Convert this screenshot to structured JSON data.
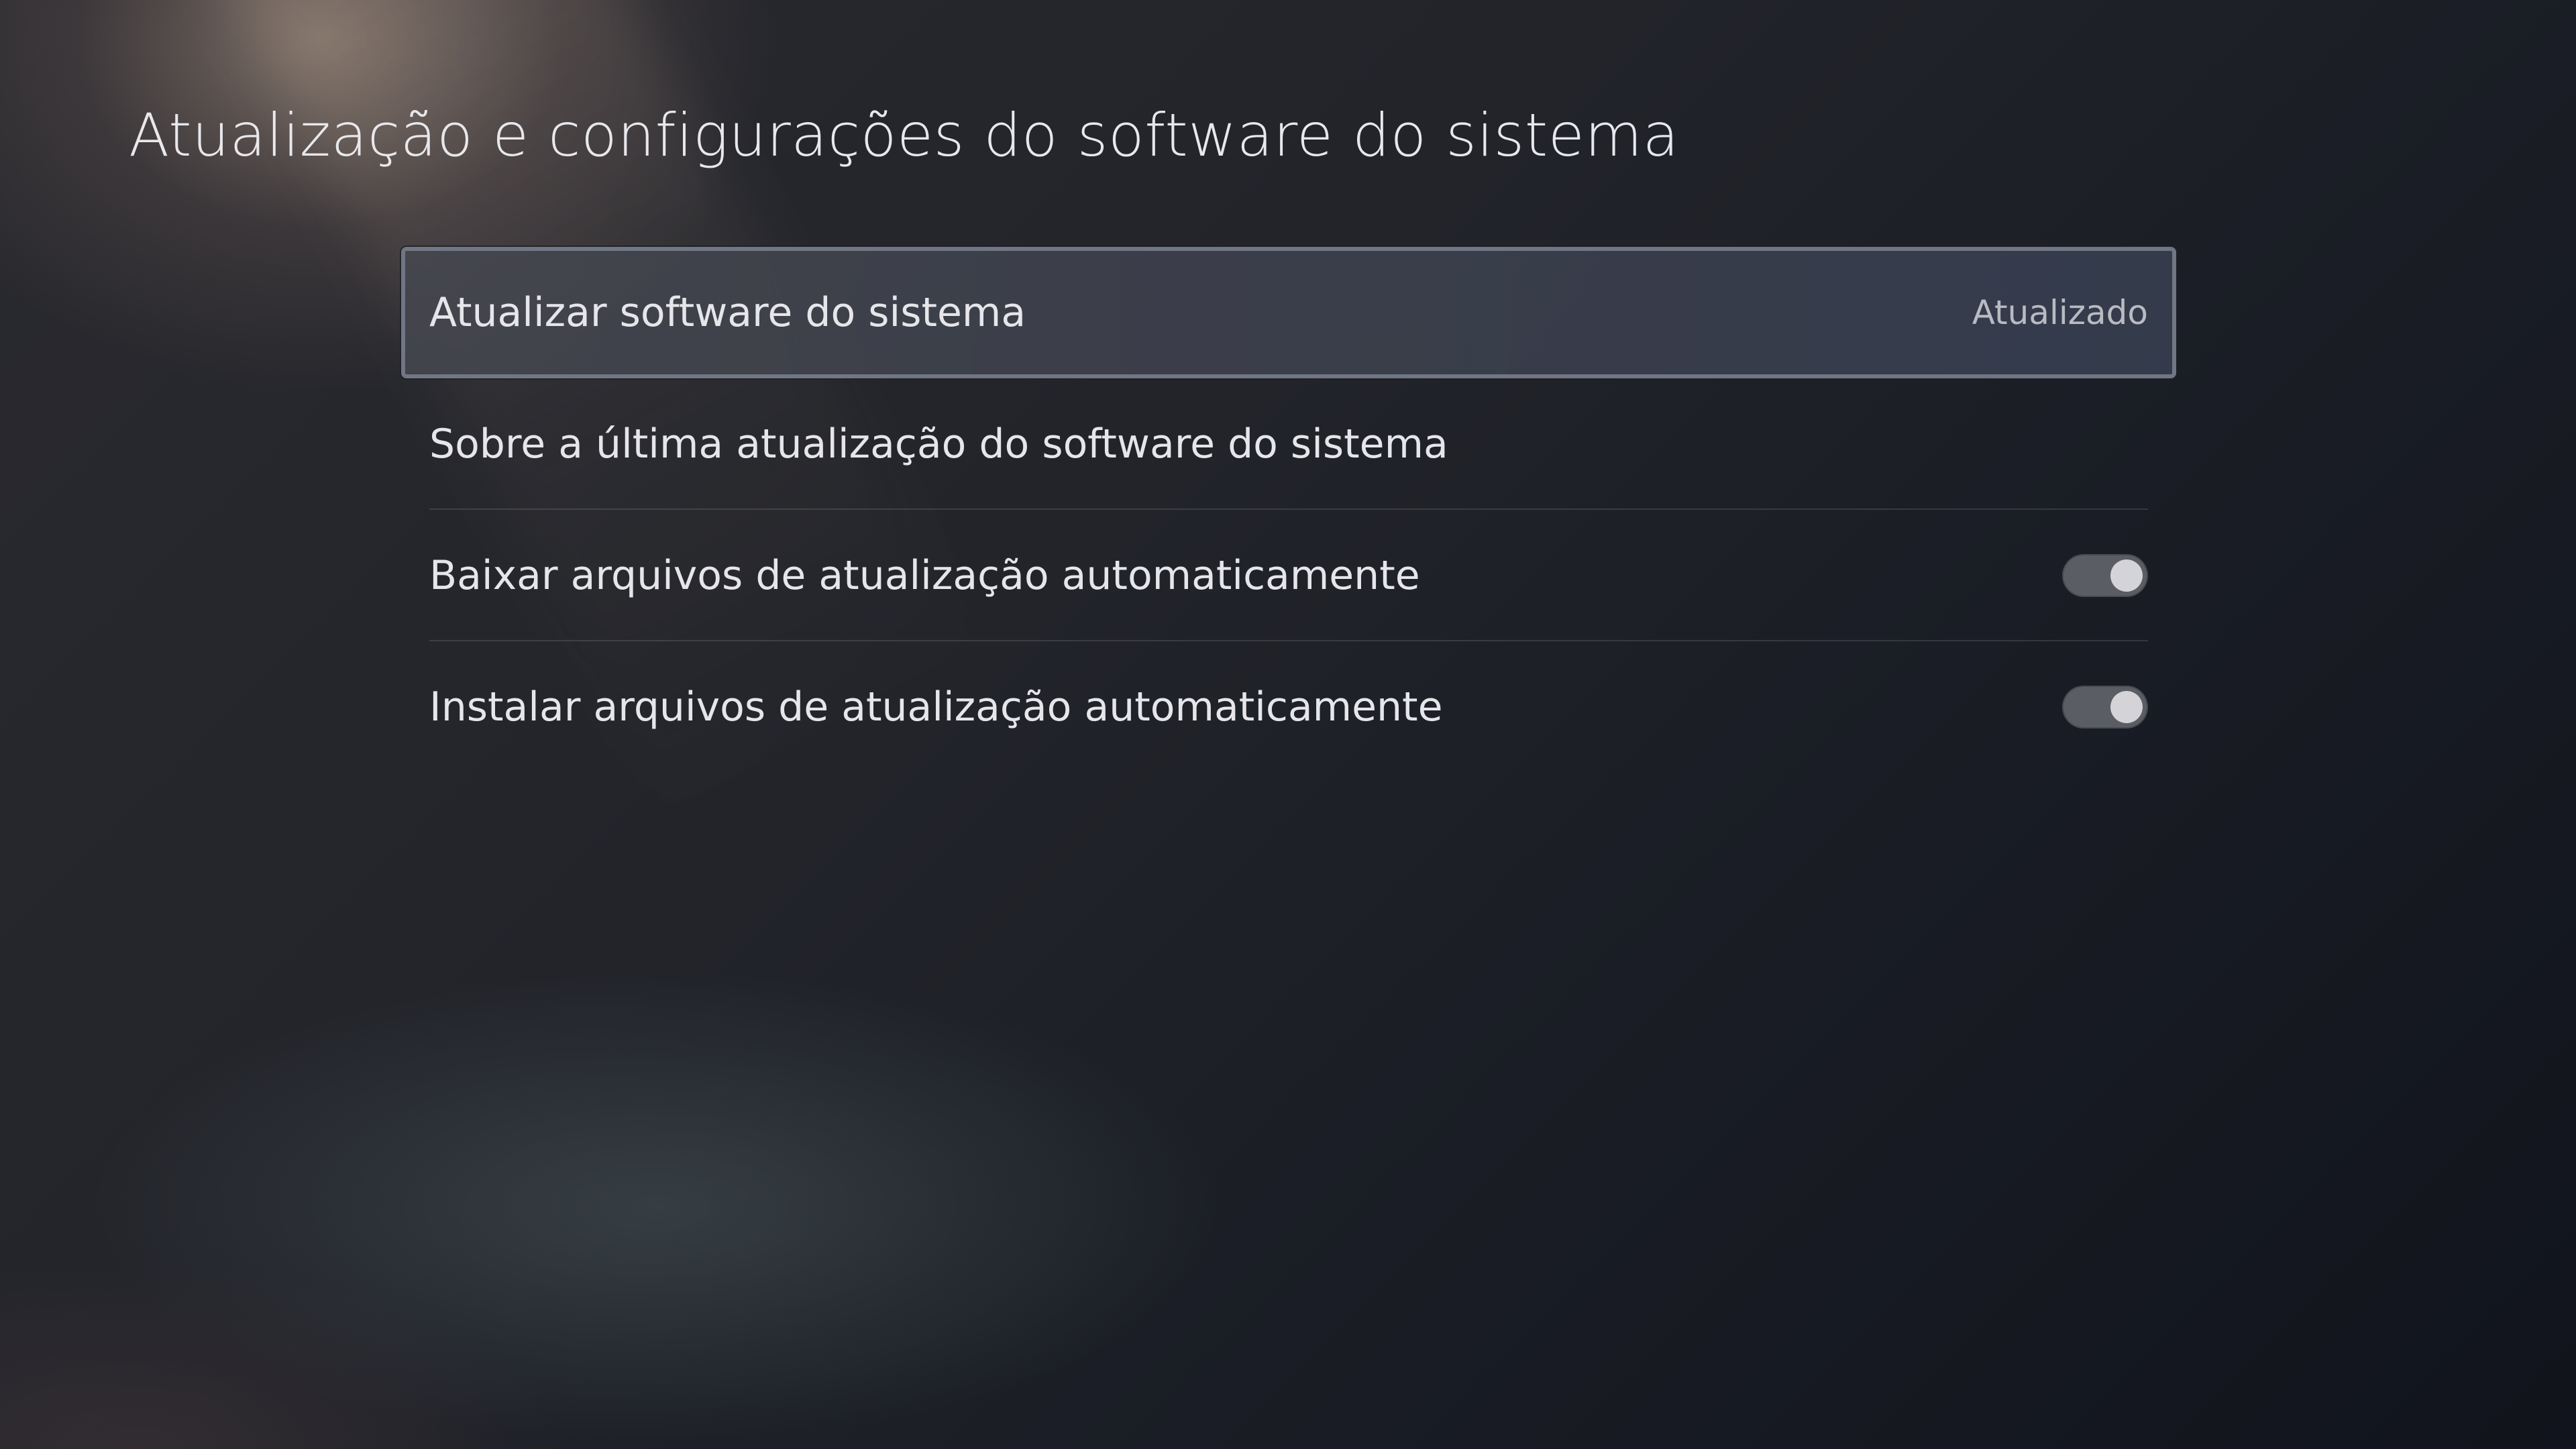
{
  "page": {
    "title": "Atualização e configurações do software do sistema"
  },
  "menu": {
    "items": [
      {
        "label": "Atualizar software do sistema",
        "status": "Atualizado",
        "focused": true
      },
      {
        "label": "Sobre a última atualização do software do sistema"
      },
      {
        "label": "Baixar arquivos de atualização automaticamente",
        "toggle": "on"
      },
      {
        "label": "Instalar arquivos de atualização automaticamente",
        "toggle": "on"
      }
    ]
  },
  "colors": {
    "toggle_track": "#5b5d64",
    "toggle_knob": "#d4d4d8",
    "focus_border": "#787d8c"
  }
}
